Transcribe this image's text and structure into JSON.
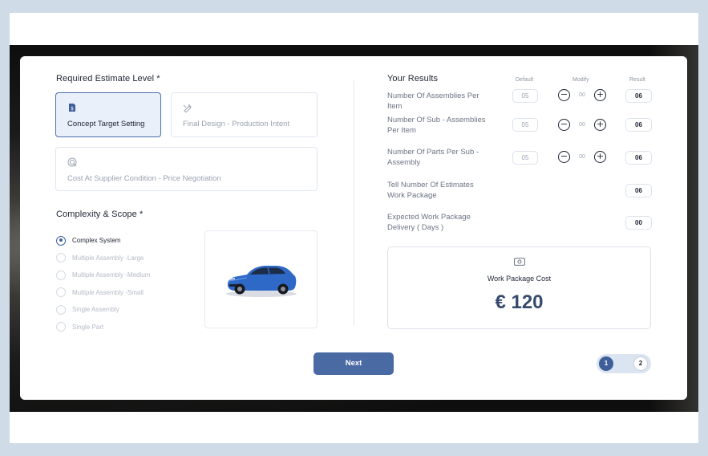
{
  "estimate": {
    "title": "Required Estimate Level *",
    "options": [
      {
        "label": "Concept Target Setting",
        "icon": "document-dollar-icon",
        "selected": true
      },
      {
        "label": "Final Design - Production Intent",
        "icon": "design-pen-icon",
        "selected": false
      },
      {
        "label": "Cost At Supplier Condition - Price Negotiation",
        "icon": "target-search-icon",
        "selected": false
      }
    ]
  },
  "complexity": {
    "title": "Complexity & Scope *",
    "items": [
      {
        "label": "Complex System",
        "checked": true
      },
      {
        "label": "Multiple Assembly -Large",
        "checked": false
      },
      {
        "label": "Multiple Assembly -Medium",
        "checked": false
      },
      {
        "label": "Multiple Assembly -Small",
        "checked": false
      },
      {
        "label": "Single Assembly",
        "checked": false
      },
      {
        "label": "Single Part",
        "checked": false
      }
    ],
    "image_icon": "blue-sedan-car"
  },
  "results": {
    "title": "Your Results",
    "col_default": "Default",
    "col_modify": "Modify",
    "col_result": "Result",
    "rows": [
      {
        "label": "Number Of Assemblies Per Item",
        "default": "05",
        "modify": "00",
        "result": "06"
      },
      {
        "label": "Number Of  Sub - Assemblies Per Item",
        "default": "05",
        "modify": "00",
        "result": "06"
      },
      {
        "label": "Number Of Parts Per Sub - Assembly",
        "default": "05",
        "modify": "00",
        "result": "06"
      },
      {
        "label": "Tell Number Of Estimates Work Package",
        "result": "06"
      },
      {
        "label": "Expected Work Package Delivery ( Days )",
        "result": "00"
      }
    ],
    "minus_symbol": "−",
    "plus_symbol": "+"
  },
  "cost": {
    "title": "Work Package Cost",
    "value": "€ 120",
    "icon": "money-bill-icon"
  },
  "footer": {
    "next_label": "Next",
    "steps": [
      "1",
      "2"
    ],
    "current_step": 1
  },
  "colors": {
    "accent": "#4a6aa3",
    "selected_bg": "#e9f0fa",
    "text_dark": "#1d2433"
  }
}
